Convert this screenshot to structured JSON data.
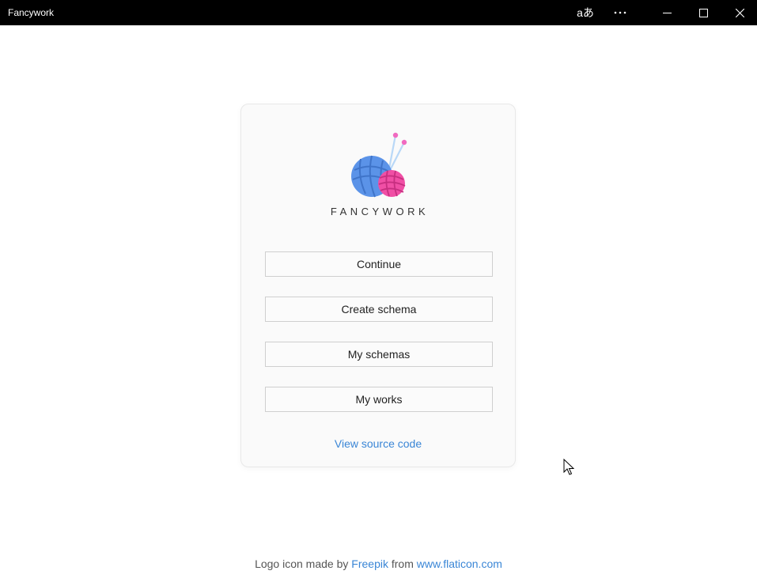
{
  "window": {
    "title": "Fancywork",
    "controls": {
      "language_icon": "translate-icon",
      "more_icon": "more-icon",
      "minimize_icon": "minimize-icon",
      "maximize_icon": "maximize-icon",
      "close_icon": "close-icon"
    }
  },
  "main": {
    "logo_icon": "yarn-balls-icon",
    "brand": "FANCYWORK",
    "buttons": [
      {
        "label": "Continue"
      },
      {
        "label": "Create schema"
      },
      {
        "label": "My schemas"
      },
      {
        "label": "My works"
      }
    ],
    "source_link": "View source code"
  },
  "footer": {
    "prefix": "Logo icon made by",
    "author": "Freepik",
    "middle": "from",
    "site": "www.flaticon.com"
  },
  "colors": {
    "titlebar": "#000000",
    "link": "#3a86d6",
    "yarn_blue": "#5b93e8",
    "yarn_pink": "#f04fa5"
  }
}
